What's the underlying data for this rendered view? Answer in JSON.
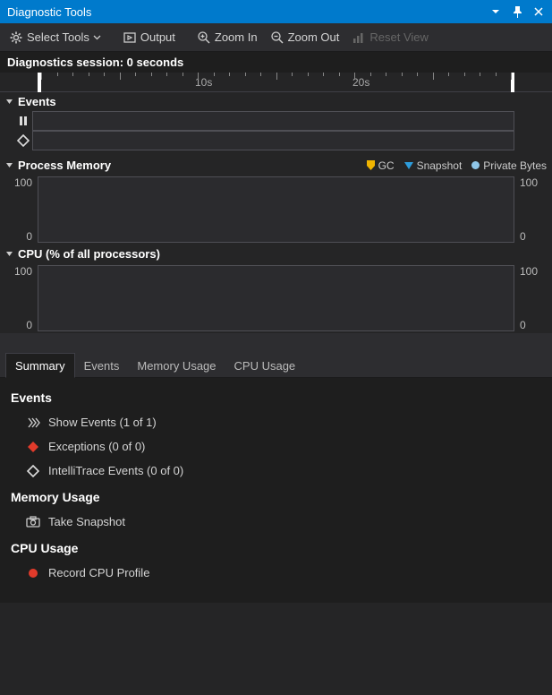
{
  "titlebar": {
    "title": "Diagnostic Tools"
  },
  "toolbar": {
    "select_tools": "Select Tools",
    "output": "Output",
    "zoom_in": "Zoom In",
    "zoom_out": "Zoom Out",
    "reset_view": "Reset View"
  },
  "session_line": "Diagnostics session: 0 seconds",
  "ruler": {
    "labels": [
      "10s",
      "20s"
    ]
  },
  "sections": {
    "events": {
      "title": "Events"
    },
    "memory": {
      "title": "Process Memory",
      "legend": {
        "gc": "GC",
        "snapshot": "Snapshot",
        "private": "Private Bytes"
      },
      "axis_top": "100",
      "axis_bottom": "0"
    },
    "cpu": {
      "title": "CPU (% of all processors)",
      "axis_top": "100",
      "axis_bottom": "0"
    }
  },
  "tabs": {
    "summary": "Summary",
    "events": "Events",
    "memory": "Memory Usage",
    "cpu": "CPU Usage"
  },
  "summary": {
    "events_hdr": "Events",
    "show_events": "Show Events (1 of 1)",
    "exceptions": "Exceptions (0 of 0)",
    "intellitrace": "IntelliTrace Events (0 of 0)",
    "memory_hdr": "Memory Usage",
    "take_snapshot": "Take Snapshot",
    "cpu_hdr": "CPU Usage",
    "record_cpu": "Record CPU Profile"
  },
  "chart_data": [
    {
      "type": "line",
      "title": "Process Memory",
      "xlabel": "",
      "ylabel": "",
      "ylim": [
        0,
        100
      ],
      "x": [],
      "series": []
    },
    {
      "type": "line",
      "title": "CPU (% of all processors)",
      "xlabel": "",
      "ylabel": "",
      "ylim": [
        0,
        100
      ],
      "x": [],
      "series": []
    }
  ]
}
